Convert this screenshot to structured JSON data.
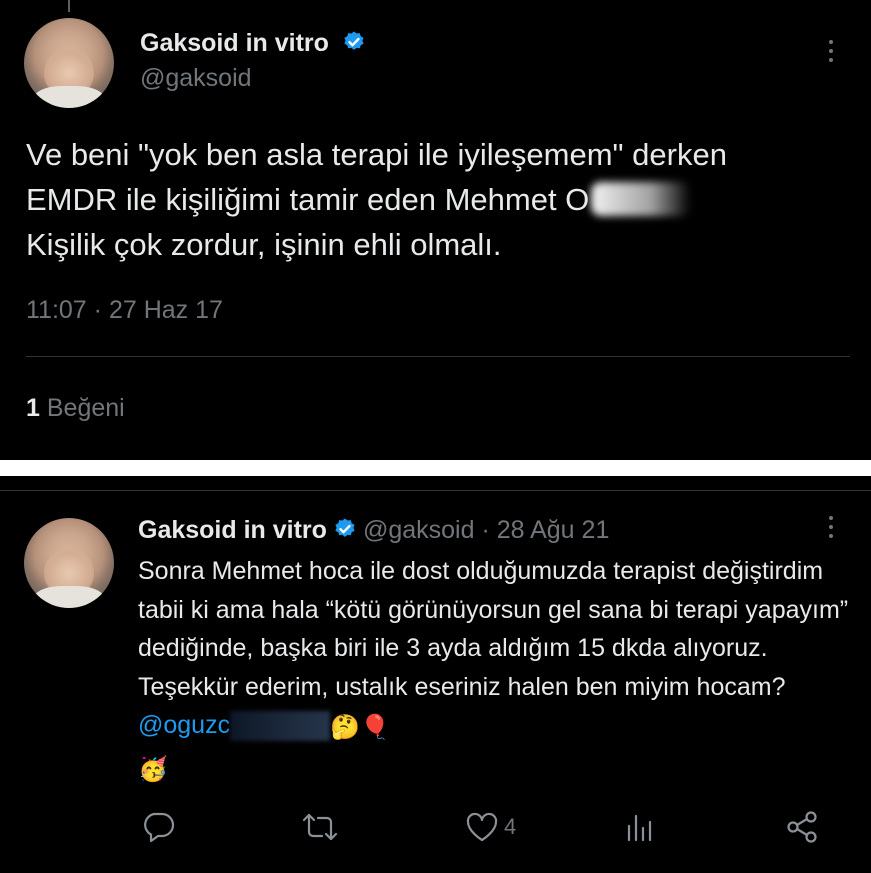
{
  "colors": {
    "background": "#000000",
    "text": "#e7e9ea",
    "secondary": "#71767b",
    "accent": "#1d9bf0",
    "verified": "#1d9bf0",
    "divider": "#ffffff"
  },
  "tweet1": {
    "display_name": "Gaksoid in vitro",
    "handle": "@gaksoid",
    "text": "Ve beni \"yok ben asla terapi ile iyileşemem\" derken\nEMDR ile kişiliğimi tamir eden Mehmet O",
    "text_after": "Kişilik çok zordur, işinin ehli olmalı.",
    "time": "11:07",
    "date_sep": "·",
    "date": "27 Haz 17",
    "likes_count": "1",
    "likes_label": "Beğeni",
    "icons": {
      "verified": "verified-badge-icon",
      "more": "more-options-icon"
    }
  },
  "tweet2": {
    "display_name": "Gaksoid in vitro",
    "handle": "@gaksoid",
    "date_sep": "·",
    "date": "28 Ağu 21",
    "text": "Sonra Mehmet hoca ile dost olduğumuzda terapist değiştirdim tabii ki ama hala “kötü görünüyorsun gel sana bi terapi yapayım” dediğinde, başka biri ile 3 ayda aldığım 15 dkda alıyoruz. Teşekkür ederim, ustalık eseriniz halen ben miyim hocam?",
    "mention": "@oguzc",
    "emojis": [
      "🤔",
      "🎈",
      "🥳"
    ],
    "actions": {
      "reply_count": "",
      "retweet_count": "",
      "like_count": "4",
      "views_count": ""
    },
    "icons": {
      "reply": "reply-icon",
      "retweet": "retweet-icon",
      "like": "like-icon",
      "views": "views-icon",
      "share": "share-icon"
    }
  }
}
